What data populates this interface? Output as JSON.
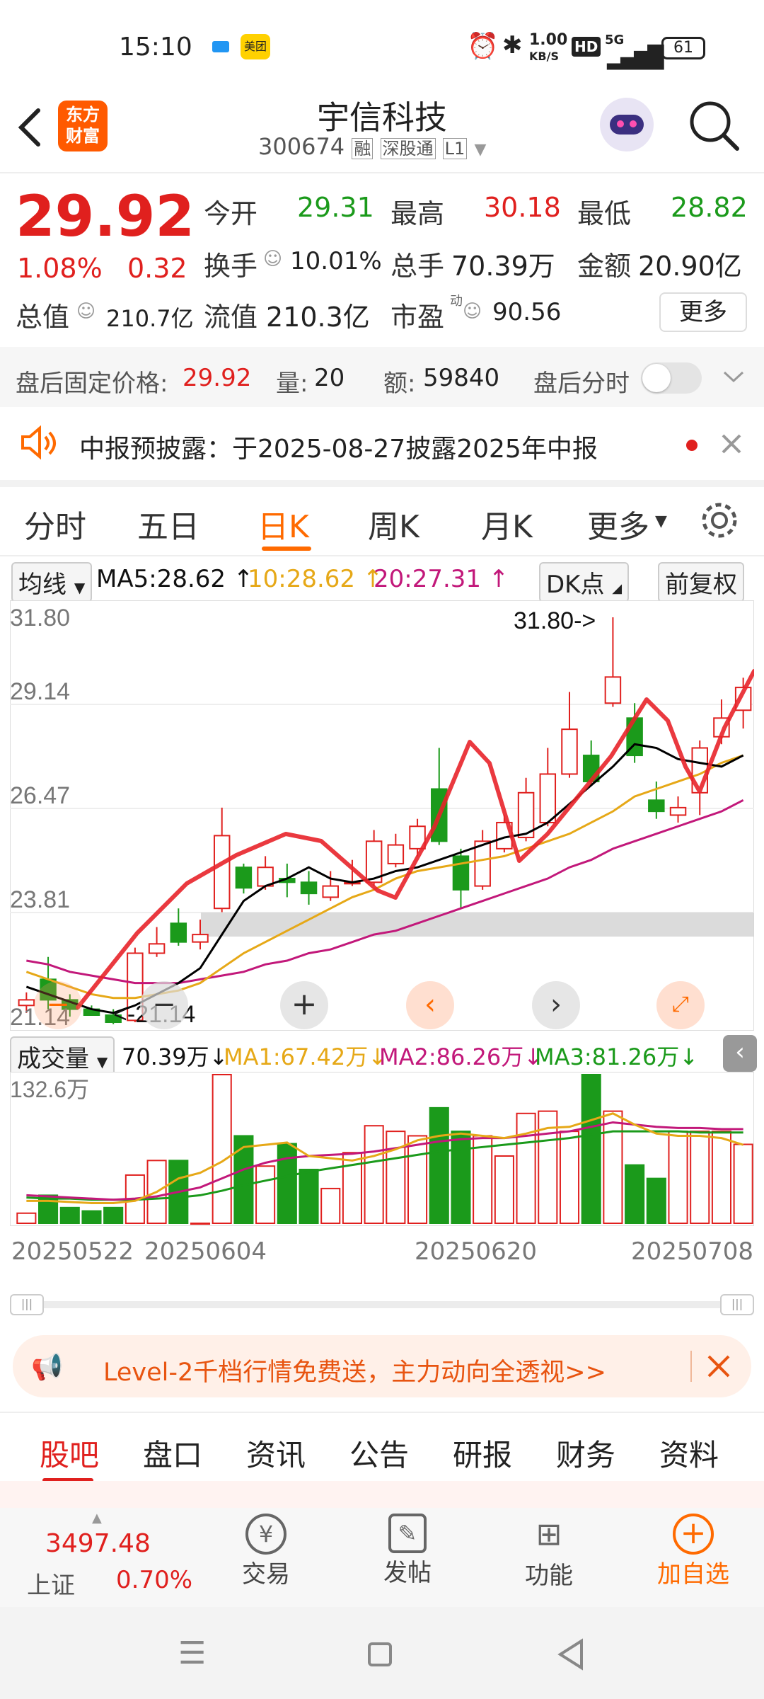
{
  "status": {
    "time": "15:10",
    "speed_top": "1.00",
    "speed_unit": "KB/S",
    "hd": "HD",
    "net": "5G",
    "battery": "61",
    "app_badge": "美团"
  },
  "header": {
    "title": "宇信科技",
    "code": "300674",
    "tag_rong": "融",
    "tag_sgt": "深股通",
    "tag_level": "L1",
    "brand_top": "东方",
    "brand_bottom": "财富"
  },
  "quote": {
    "price": "29.92",
    "change_pct": "1.08%",
    "change_abs": "0.32",
    "open_label": "今开",
    "open": "29.31",
    "high_label": "最高",
    "high": "30.18",
    "low_label": "最低",
    "low": "28.82",
    "turnover_label": "换手",
    "turnover": "10.01%",
    "volume_label": "总手",
    "volume": "70.39万",
    "amount_label": "金额",
    "amount": "20.90亿",
    "mktcap_label": "总值",
    "mktcap": "210.7亿",
    "float_label": "流值",
    "float_cap": "210.3亿",
    "pe_label": "市盈",
    "pe_sup": "动",
    "pe": "90.56",
    "more": "更多"
  },
  "afterhours": {
    "label": "盘后固定价格:",
    "price": "29.92",
    "vol_label": "量:",
    "vol": "20",
    "amt_label": "额:",
    "amt": "59840",
    "toggle_label": "盘后分时"
  },
  "notice": {
    "text": "中报预披露：于2025-08-27披露2025年中报"
  },
  "tabs": {
    "t1": "分时",
    "t2": "五日",
    "t3": "日K",
    "t4": "周K",
    "t5": "月K",
    "t6": "更多"
  },
  "ma_legend": {
    "selector": "均线",
    "ma5": "MA5:28.62",
    "ma10": "10:28.62",
    "ma20": "20:27.31",
    "dk": "DK点",
    "fq": "前复权"
  },
  "chart_labels": {
    "y1": "31.80",
    "y2": "29.14",
    "y3": "26.47",
    "y4": "23.81",
    "y5": "21.14",
    "max_mark": "31.80->",
    "min_mark": "<-21.14"
  },
  "vol_legend": {
    "selector": "成交量",
    "vol": "70.39万",
    "ma1": "MA1:67.42万",
    "ma2": "MA2:86.26万",
    "ma3": "MA3:81.26万",
    "ymax": "132.6万"
  },
  "dates": {
    "d1": "20250522",
    "d2": "20250604",
    "d3": "20250620",
    "d4": "20250708"
  },
  "ad": {
    "text": "Level-2千档行情免费送，主力动向全透视>>"
  },
  "subtabs": {
    "s1": "股吧",
    "s2": "盘口",
    "s3": "资讯",
    "s4": "公告",
    "s5": "研报",
    "s6": "财务",
    "s7": "资料"
  },
  "bottomnav": {
    "index_value": "3497.48",
    "index_name": "上证",
    "index_pct": "0.70%",
    "trade": "交易",
    "post": "发帖",
    "func": "功能",
    "add": "加自选"
  },
  "colors": {
    "up": "#e0201e",
    "down": "#1b9a1b",
    "ma5": "#000000",
    "ma10": "#e6a817",
    "ma20": "#c2187a",
    "accent": "#ff6a00"
  },
  "chart_data": {
    "type": "candlestick",
    "ylim": [
      21.14,
      31.8
    ],
    "candles": [
      {
        "o": 21.4,
        "c": 21.55,
        "h": 21.75,
        "l": 21.2
      },
      {
        "o": 22.1,
        "c": 21.55,
        "h": 22.7,
        "l": 21.3
      },
      {
        "o": 21.55,
        "c": 21.3,
        "h": 21.7,
        "l": 21.1
      },
      {
        "o": 21.3,
        "c": 21.14,
        "h": 21.4,
        "l": 21.14
      },
      {
        "o": 21.14,
        "c": 20.95,
        "h": 21.3,
        "l": 20.9
      },
      {
        "o": 21.0,
        "c": 22.8,
        "h": 22.95,
        "l": 20.95
      },
      {
        "o": 22.8,
        "c": 23.05,
        "h": 23.5,
        "l": 22.7
      },
      {
        "o": 23.6,
        "c": 23.1,
        "h": 24.0,
        "l": 23.0
      },
      {
        "o": 23.1,
        "c": 23.3,
        "h": 23.7,
        "l": 22.9
      },
      {
        "o": 24.0,
        "c": 25.95,
        "h": 26.7,
        "l": 23.9
      },
      {
        "o": 25.1,
        "c": 24.55,
        "h": 25.2,
        "l": 24.4
      },
      {
        "o": 24.6,
        "c": 25.1,
        "h": 25.4,
        "l": 24.5
      },
      {
        "o": 24.8,
        "c": 24.7,
        "h": 25.2,
        "l": 24.3
      },
      {
        "o": 24.7,
        "c": 24.4,
        "h": 25.0,
        "l": 24.1
      },
      {
        "o": 24.3,
        "c": 24.6,
        "h": 25.0,
        "l": 24.2
      },
      {
        "o": 24.7,
        "c": 24.7,
        "h": 25.3,
        "l": 24.6
      },
      {
        "o": 24.7,
        "c": 25.8,
        "h": 26.1,
        "l": 24.6
      },
      {
        "o": 25.2,
        "c": 25.7,
        "h": 26.0,
        "l": 25.1
      },
      {
        "o": 25.6,
        "c": 26.2,
        "h": 26.4,
        "l": 25.4
      },
      {
        "o": 27.2,
        "c": 25.8,
        "h": 28.3,
        "l": 25.7
      },
      {
        "o": 25.4,
        "c": 24.5,
        "h": 25.6,
        "l": 24.0
      },
      {
        "o": 24.6,
        "c": 25.8,
        "h": 26.1,
        "l": 24.5
      },
      {
        "o": 25.6,
        "c": 26.3,
        "h": 26.5,
        "l": 25.5
      },
      {
        "o": 25.9,
        "c": 27.1,
        "h": 27.5,
        "l": 25.8
      },
      {
        "o": 26.3,
        "c": 27.6,
        "h": 28.3,
        "l": 26.2
      },
      {
        "o": 27.6,
        "c": 28.8,
        "h": 29.8,
        "l": 27.5
      },
      {
        "o": 28.1,
        "c": 27.4,
        "h": 28.5,
        "l": 27.3
      },
      {
        "o": 29.5,
        "c": 30.2,
        "h": 31.8,
        "l": 29.4
      },
      {
        "o": 29.1,
        "c": 28.1,
        "h": 29.5,
        "l": 27.9
      },
      {
        "o": 26.9,
        "c": 26.6,
        "h": 27.4,
        "l": 26.4
      },
      {
        "o": 26.5,
        "c": 26.7,
        "h": 27.0,
        "l": 26.3
      },
      {
        "o": 27.1,
        "c": 28.3,
        "h": 28.5,
        "l": 26.5
      },
      {
        "o": 28.6,
        "c": 29.1,
        "h": 29.6,
        "l": 28.4
      },
      {
        "o": 29.31,
        "c": 29.92,
        "h": 30.18,
        "l": 28.82
      }
    ],
    "ma5": [
      21.9,
      21.7,
      21.5,
      21.3,
      21.2,
      21.4,
      21.7,
      22.0,
      22.4,
      23.3,
      24.2,
      24.6,
      24.8,
      25.1,
      24.8,
      24.7,
      24.8,
      25.0,
      25.1,
      25.3,
      25.5,
      25.7,
      25.9,
      26.0,
      26.3,
      26.8,
      27.3,
      27.8,
      28.4,
      28.3,
      28.0,
      27.9,
      27.8,
      28.1
    ],
    "ma10": [
      22.3,
      22.1,
      21.9,
      21.7,
      21.6,
      21.6,
      21.7,
      21.8,
      22.0,
      22.4,
      22.8,
      23.1,
      23.4,
      23.7,
      24.0,
      24.3,
      24.5,
      24.8,
      25.0,
      25.1,
      25.2,
      25.3,
      25.4,
      25.6,
      25.8,
      26.0,
      26.3,
      26.6,
      27.0,
      27.2,
      27.4,
      27.6,
      27.9,
      28.1
    ],
    "ma20": [
      22.6,
      22.5,
      22.3,
      22.2,
      22.1,
      22.0,
      22.0,
      22.0,
      22.1,
      22.2,
      22.3,
      22.5,
      22.6,
      22.8,
      22.9,
      23.1,
      23.3,
      23.4,
      23.6,
      23.8,
      24.0,
      24.2,
      24.4,
      24.6,
      24.8,
      25.1,
      25.3,
      25.6,
      25.8,
      26.0,
      26.2,
      26.4,
      26.6,
      26.9
    ],
    "volume": {
      "ylim": [
        0,
        132.6
      ],
      "values": [
        9,
        25,
        14,
        11,
        14,
        43,
        56,
        56,
        0,
        132.6,
        78,
        51,
        71,
        48,
        31,
        63,
        87,
        82,
        78,
        103,
        82,
        78,
        60,
        98,
        100,
        82,
        132.6,
        100,
        52,
        40,
        82,
        82,
        82,
        70.39
      ],
      "ma1": [
        20,
        20,
        19,
        18,
        18,
        20,
        28,
        40,
        45,
        55,
        68,
        70,
        72,
        60,
        58,
        56,
        60,
        66,
        74,
        78,
        80,
        78,
        76,
        80,
        85,
        86,
        92,
        98,
        88,
        80,
        78,
        78,
        76,
        70
      ],
      "ma2": [
        25,
        24,
        23,
        22,
        21,
        22,
        24,
        28,
        32,
        40,
        48,
        54,
        58,
        60,
        61,
        62,
        64,
        67,
        70,
        73,
        75,
        76,
        76,
        78,
        80,
        82,
        86,
        90,
        88,
        86,
        85,
        85,
        84,
        84
      ],
      "ma3": [
        23,
        22,
        22,
        21,
        21,
        21,
        22,
        23,
        25,
        29,
        34,
        38,
        42,
        46,
        49,
        52,
        55,
        58,
        61,
        64,
        66,
        68,
        70,
        72,
        74,
        76,
        79,
        82,
        82,
        82,
        82,
        81,
        81,
        81
      ]
    }
  }
}
